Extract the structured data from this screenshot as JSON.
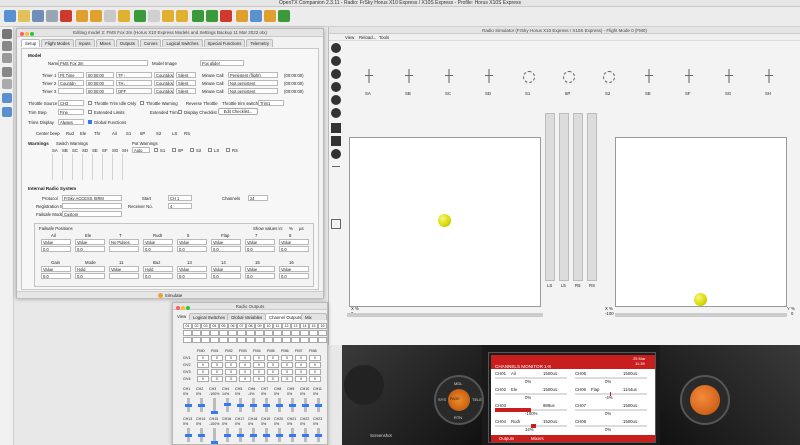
{
  "app": {
    "title": "OpenTX Companion 2.3.11 - Radio: FrSky Horus X10 Express / X10S Express - Profile: Horus X10S Express"
  },
  "editor": {
    "title": "Editing model 2: FMS Fox 3m   (Horus X10 Express Models and Settings Backup 11 Mar 2022.otx)",
    "tabs": [
      "Setup",
      "Flight Modes",
      "Inputs",
      "Mixes",
      "Outputs",
      "Curves",
      "Logical Switches",
      "Special Functions",
      "Telemetry"
    ],
    "model_label": "Model",
    "name_label": "Name",
    "name_value": "FMS Fox 3m",
    "image_label": "Model Image",
    "image_value": "Fox glider",
    "timers": [
      {
        "label": "Timer 1",
        "name": "Flt Time",
        "time": "00:00:00",
        "switch": "TF↑",
        "mode": "Countdown",
        "beep": "Silent",
        "mc_label": "Minute Call",
        "persist": "Persistent (flight)",
        "reset": "(00:00:00)"
      },
      {
        "label": "Timer 2",
        "name": "Countdn",
        "time": "00:00:00",
        "switch": "TH↓",
        "mode": "Countdown",
        "beep": "Silent",
        "mc_label": "Minute Call",
        "persist": "Not persistent",
        "reset": "(00:00:00)"
      },
      {
        "label": "Timer 3",
        "name": "",
        "time": "00:00:00",
        "switch": "OFF",
        "mode": "Countdown",
        "beep": "Silent",
        "mc_label": "Minute Call",
        "persist": "Not persistent",
        "reset": "(00:00:00)"
      }
    ],
    "throttle_source_label": "Throttle Source",
    "throttle_source": "CH3",
    "throttle_trim_idle": "Throttle Trim Idle Only",
    "throttle_warning": "Throttle Warning",
    "reverse_throttle": "Reverse Throttle",
    "throttle_trim_switch_label": "Throttle trim switch",
    "throttle_trim_switch": "Trim1",
    "trim_step_label": "Trim Step",
    "trim_step": "Fine",
    "extended_limits": "Extended Limits",
    "extended_trims": "Extended Trims",
    "display_checklist": "Display Checklist",
    "edit_checklist": "Edit Checklist...",
    "trims_display_label": "Trims Display",
    "trims_display": "Always",
    "global_functions": "Global Functions",
    "center_beep_label": "Center beep",
    "center_beep": [
      "Rud",
      "Ele",
      "Thr",
      "Ail",
      "S1",
      "6P",
      "S2",
      "LS",
      "RS"
    ],
    "warnings_label": "Warnings",
    "switch_warnings_label": "Switch Warnings",
    "switch_names": [
      "SA",
      "SB",
      "SC",
      "SD",
      "SE",
      "SF",
      "SG",
      "SH"
    ],
    "pot_warnings_label": "Pot Warnings",
    "pot_mode": "Auto",
    "pot_names": [
      "S1",
      "6P",
      "S2",
      "LS",
      "RS"
    ],
    "irs_label": "Internal Radio System",
    "protocol_label": "Protocol",
    "protocol": "FrSky ACCESS ISRM",
    "start_label": "Start",
    "start_value": "CH 1",
    "channels_label": "Channels",
    "channels_value": "24",
    "reg_id_label": "Registration ID",
    "receiver_label": "Receiver No.",
    "receiver_value": "4",
    "failsafe_label": "Failsafe Mode",
    "failsafe_mode": "Custom",
    "failsafe_positions_label": "Failsafe Positions",
    "show_values_label": "Show values in:",
    "show_values": [
      "%",
      "µs"
    ],
    "fs_row1_headers": [
      "Ail",
      "Ele",
      "T",
      "Rudr",
      "5",
      "Flap",
      "7",
      "8"
    ],
    "fs_row1_modes": [
      "Value",
      "Value",
      "No Pulses",
      "Value",
      "Value",
      "Value",
      "Value",
      "Value"
    ],
    "fs_row1_values": [
      "0.0",
      "0.0",
      "",
      "0.0",
      "0.0",
      "0.0",
      "0.0",
      "0.0"
    ],
    "fs_row2_headers": [
      "Gain",
      "Mode",
      "11",
      "Buz",
      "13",
      "14",
      "15",
      "16"
    ],
    "fs_row2_modes": [
      "Value",
      "Hold",
      "Value",
      "Hold",
      "Value",
      "Value",
      "Value",
      "Value"
    ],
    "fs_row2_values": [
      "0.0",
      "0.0",
      "",
      "0.0",
      "0.0",
      "0.0",
      "0.0",
      "0.0"
    ],
    "simulate": "Simulate"
  },
  "simulator": {
    "title": "Radio Simulator (FrSky Horus X10 Express / X10S Express) - Flight Mode 0 (FM0)",
    "menu": [
      "View",
      "Reload...",
      "Tools"
    ],
    "switches": [
      "SA",
      "SB",
      "SC",
      "SD",
      "S1",
      "6P",
      "S2",
      "SE",
      "SF",
      "SG",
      "SH"
    ],
    "slider_labels": [
      "LS",
      "L5",
      "R5",
      "RS"
    ],
    "left_x_label": "X %",
    "left_x_value": "0",
    "right_x_label": "X %",
    "right_x_value": "-100",
    "right_y_label": "Y %",
    "right_y_value": "0",
    "screenshot_label": "Screenshot"
  },
  "radio_screen": {
    "date": "25 Mar",
    "time": "11:39",
    "header": "CHANNELS MONITOR 1-8",
    "channels": [
      {
        "num": "CH01",
        "name": "Ail",
        "us": "1500us",
        "pct": "0%"
      },
      {
        "num": "CH02",
        "name": "Ele",
        "us": "1500us",
        "pct": "0%"
      },
      {
        "num": "CH03",
        "name": "",
        "us": "988us",
        "pct": "-100%"
      },
      {
        "num": "CH04",
        "name": "Rudr",
        "us": "1520us",
        "pct": "14%"
      },
      {
        "num": "CH05",
        "name": "",
        "us": "1500us",
        "pct": "0%"
      },
      {
        "num": "CH06",
        "name": "Flap",
        "us": "1144us",
        "pct": "-4%"
      },
      {
        "num": "CH07",
        "name": "",
        "us": "1500us",
        "pct": "0%"
      },
      {
        "num": "CH08",
        "name": "",
        "us": "1500us",
        "pct": "0%"
      }
    ],
    "footer": [
      "Outputs",
      "Mixers"
    ],
    "bezel_buttons": [
      "MDL",
      "SYS",
      "RTN",
      "TELE",
      "PAGE"
    ]
  },
  "outputs": {
    "title": "Radio Outputs",
    "tabs": [
      "Logical Switches",
      "Global Variables",
      "Channel Outputs",
      "Mix Outputs"
    ],
    "view_label": "View",
    "ls_numbers": [
      "01",
      "02",
      "03",
      "04",
      "05",
      "06",
      "07",
      "08",
      "09",
      "10",
      "11",
      "12",
      "13",
      "14",
      "15",
      "16"
    ],
    "fm_headers": [
      "FM0",
      "FM1",
      "FM2",
      "FM3",
      "FM4",
      "FM5",
      "FM6",
      "FM7",
      "FM8"
    ],
    "gv_rows": [
      "GV1",
      "GV2",
      "GV3",
      "GV4"
    ],
    "gv_values": [
      "0",
      "0",
      "0",
      "0",
      "0",
      "0",
      "0",
      "0",
      "0"
    ],
    "ch_row1": [
      "CH1",
      "CH2",
      "CH3",
      "CH4",
      "CH5",
      "CH6",
      "CH7",
      "CH8",
      "CH9",
      "CH10",
      "CH11"
    ],
    "ch_row1_vals": [
      "0%",
      "0%",
      "-100%",
      "14%",
      "0%",
      "-4%",
      "0%",
      "0%",
      "0%",
      "0%",
      "0%"
    ],
    "ch_row2": [
      "CH13",
      "CH14",
      "CH15",
      "CH16",
      "CH17",
      "CH18",
      "CH19",
      "CH20",
      "CH21",
      "CH22",
      "CH23"
    ],
    "ch_row2_vals": [
      "0%",
      "0%",
      "-100%",
      "0%",
      "0%",
      "0%",
      "0%",
      "0%",
      "0%",
      "0%",
      "0%"
    ]
  },
  "colors": {
    "accent_blue": "#3478f6",
    "radio_red": "#c81e1e",
    "knob_orange": "#e8701a",
    "joystick_yellow": "#e0e000"
  }
}
